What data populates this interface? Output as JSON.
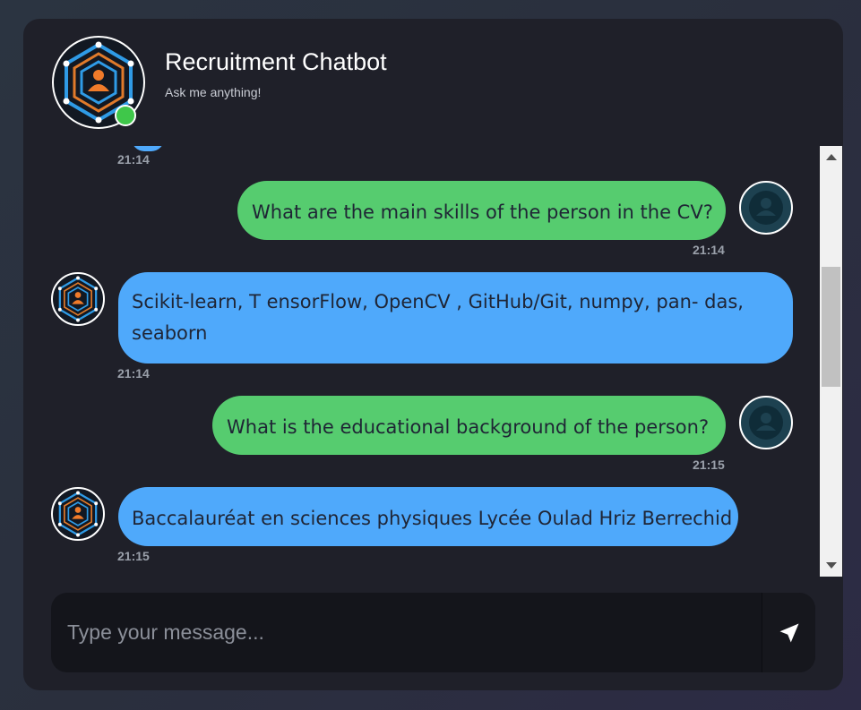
{
  "header": {
    "title": "Recruitment Chatbot",
    "subtitle": "Ask me anything!",
    "status": "online"
  },
  "messages": [
    {
      "sender": "bot",
      "text": "",
      "time": "21:14"
    },
    {
      "sender": "user",
      "text": "What are the main skills of the person in the CV?",
      "time": "21:14"
    },
    {
      "sender": "bot",
      "lines": [
        "Scikit-learn, T ensorFlow, OpenCV , GitHub/Git, numpy, pan- das,",
        "seaborn"
      ],
      "time": "21:14"
    },
    {
      "sender": "user",
      "text": "What is the educational background of the person?",
      "time": "21:15"
    },
    {
      "sender": "bot",
      "text": "Baccalauréat en sciences physiques Lycée Oulad Hriz Berrechid",
      "time": "21:15"
    }
  ],
  "input": {
    "placeholder": "Type your message...",
    "value": ""
  },
  "icons": {
    "bot_avatar": "chatbot-logo-icon",
    "user_avatar": "user-icon",
    "send": "send-icon"
  },
  "colors": {
    "user_bubble": "#56cc6f",
    "bot_bubble": "#4fa9fb",
    "online": "#3fc74a",
    "card": "#1f2029"
  }
}
